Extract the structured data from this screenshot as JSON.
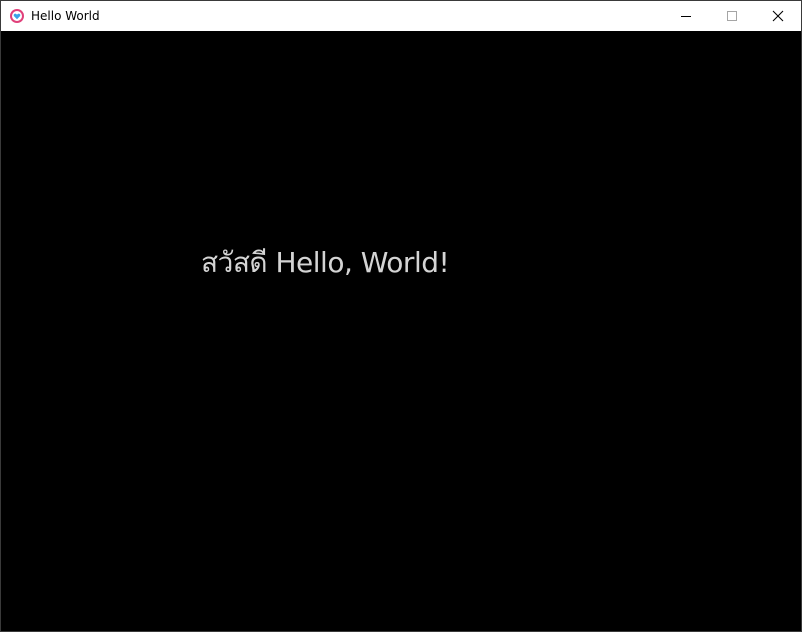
{
  "window": {
    "title": "Hello World",
    "icons": {
      "app": "heart-icon",
      "minimize": "minimize-icon",
      "maximize": "maximize-icon",
      "close": "close-icon"
    },
    "colors": {
      "app_icon_ring": "#e0407a",
      "app_icon_heart": "#3ba3e8",
      "background": "#000000",
      "text": "#d4d4d4"
    }
  },
  "content": {
    "greeting": "สวัสดี Hello, World!"
  }
}
